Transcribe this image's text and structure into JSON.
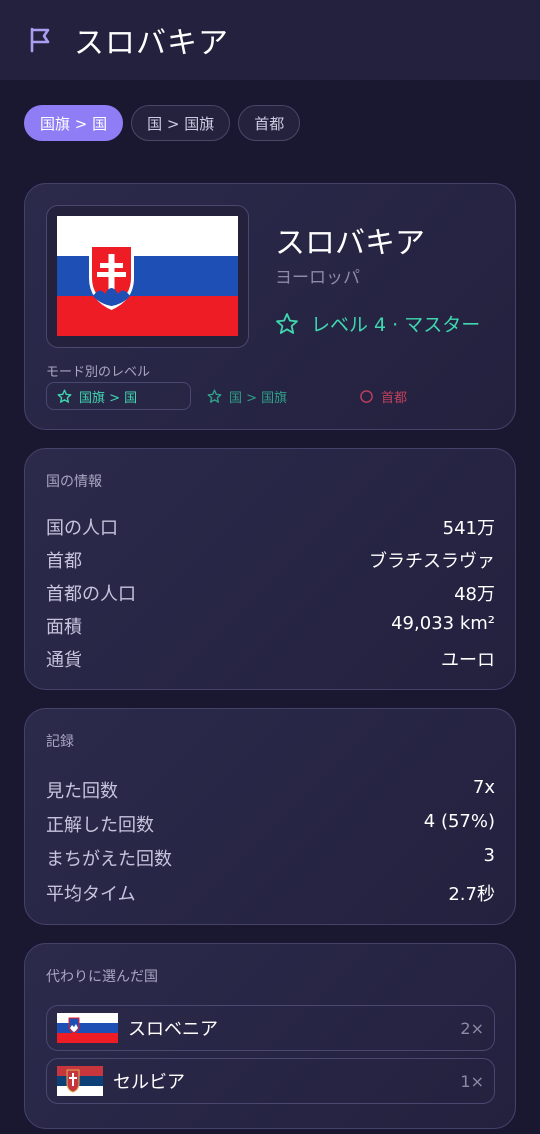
{
  "header": {
    "title": "スロバキア",
    "icon": "flag-outline-icon"
  },
  "tabs": [
    {
      "label": "国旗 > 国",
      "active": true
    },
    {
      "label": "国 > 国旗",
      "active": false
    },
    {
      "label": "首都",
      "active": false
    }
  ],
  "country": {
    "name": "スロバキア",
    "region": "ヨーロッパ",
    "level_label": "レベル 4 · マスター",
    "flag": "slovakia-flag"
  },
  "modes": {
    "label": "モード別のレベル",
    "items": [
      {
        "label": "国旗 > 国",
        "icon": "star-outline-icon"
      },
      {
        "label": "国 > 国旗",
        "icon": "star-outline-icon"
      },
      {
        "label": "首都",
        "icon": "circle-outline-icon"
      }
    ]
  },
  "info": {
    "title": "国の情報",
    "rows": [
      {
        "key": "国の人口",
        "value": "541万"
      },
      {
        "key": "首都",
        "value": "ブラチスラヴァ"
      },
      {
        "key": "首都の人口",
        "value": "48万"
      },
      {
        "key": "面積",
        "value": "49,033 km²"
      },
      {
        "key": "通貨",
        "value": "ユーロ"
      }
    ]
  },
  "stats": {
    "title": "記録",
    "rows": [
      {
        "key": "見た回数",
        "value": "7x"
      },
      {
        "key": "正解した回数",
        "value": "4 (57%)"
      },
      {
        "key": "まちがえた回数",
        "value": "3"
      },
      {
        "key": "平均タイム",
        "value": "2.7秒"
      }
    ]
  },
  "alternatives": {
    "title": "代わりに選んだ国",
    "items": [
      {
        "name": "スロベニア",
        "count": "2×",
        "flag": "slovenia-flag"
      },
      {
        "name": "セルビア",
        "count": "1×",
        "flag": "serbia-flag"
      }
    ]
  },
  "colors": {
    "accent": "#8e7df5",
    "success": "#3fd6b0",
    "error": "#c0405e",
    "background": "#1a1831",
    "card": "#2a2848"
  }
}
